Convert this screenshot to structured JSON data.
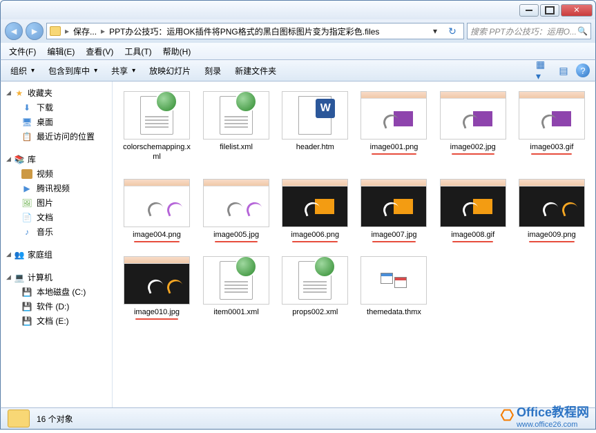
{
  "titlebar": {},
  "address": {
    "seg1": "保存...",
    "seg2": "PPT办公技巧：运用OK插件将PNG格式的黑白图标图片变为指定彩色.files",
    "search_placeholder": "搜索 PPT办公技巧：运用O..."
  },
  "menus": {
    "file": "文件(F)",
    "edit": "编辑(E)",
    "view": "查看(V)",
    "tools": "工具(T)",
    "help": "帮助(H)"
  },
  "toolbar": {
    "organize": "组织",
    "include": "包含到库中",
    "share": "共享",
    "slideshow": "放映幻灯片",
    "burn": "刻录",
    "newfolder": "新建文件夹"
  },
  "sidebar": {
    "favorites": "收藏夹",
    "downloads": "下载",
    "desktop": "桌面",
    "recent": "最近访问的位置",
    "libraries": "库",
    "videos": "视频",
    "tencent": "腾讯视频",
    "pictures": "图片",
    "documents": "文档",
    "music": "音乐",
    "homegroup": "家庭组",
    "computer": "计算机",
    "disk_c": "本地磁盘 (C:)",
    "disk_d": "软件 (D:)",
    "disk_e": "文档 (E:)"
  },
  "files": [
    {
      "name": "colorschemapping.xml",
      "type": "xml",
      "ul": false
    },
    {
      "name": "filelist.xml",
      "type": "xml",
      "ul": false
    },
    {
      "name": "header.htm",
      "type": "word",
      "ul": false
    },
    {
      "name": "image001.png",
      "type": "ppt1",
      "ul": true
    },
    {
      "name": "image002.jpg",
      "type": "ppt1",
      "ul": true
    },
    {
      "name": "image003.gif",
      "type": "ppt1",
      "ul": true
    },
    {
      "name": "image004.png",
      "type": "ppt2",
      "ul": true
    },
    {
      "name": "image005.jpg",
      "type": "ppt2",
      "ul": true
    },
    {
      "name": "image006.png",
      "type": "ppt3",
      "ul": true
    },
    {
      "name": "image007.jpg",
      "type": "ppt3",
      "ul": true
    },
    {
      "name": "image008.gif",
      "type": "ppt3",
      "ul": true
    },
    {
      "name": "image009.png",
      "type": "ppt4",
      "ul": true
    },
    {
      "name": "image010.jpg",
      "type": "ppt4",
      "ul": true
    },
    {
      "name": "item0001.xml",
      "type": "xml",
      "ul": false
    },
    {
      "name": "props002.xml",
      "type": "xml",
      "ul": false
    },
    {
      "name": "themedata.thmx",
      "type": "theme",
      "ul": false
    }
  ],
  "status": {
    "count": "16 个对象"
  },
  "watermark": {
    "title": "Office教程网",
    "url": "www.office26.com"
  }
}
